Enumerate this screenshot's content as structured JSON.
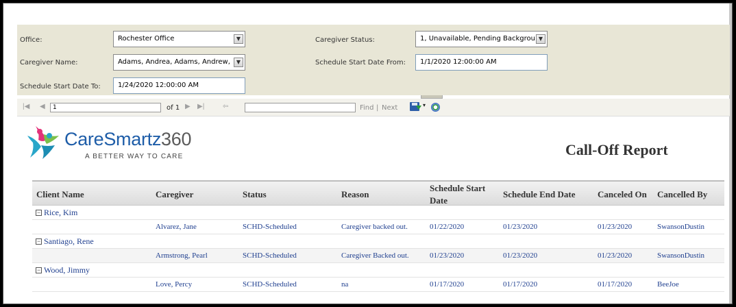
{
  "params": {
    "office_label": "Office:",
    "office_value": "Rochester Office",
    "caregiver_status_label": "Caregiver Status:",
    "caregiver_status_value": "1, Unavailable, Pending Backgrou",
    "caregiver_name_label": "Caregiver Name:",
    "caregiver_name_value": "Adams, Andrea, Adams, Andrew,",
    "start_from_label": "Schedule Start Date From:",
    "start_from_value": "1/1/2020 12:00:00 AM",
    "start_to_label": "Schedule Start Date To:",
    "start_to_value": "1/24/2020 12:00:00 AM"
  },
  "toolbar": {
    "page_value": "1",
    "of_label": "of 1",
    "find_label": "Find",
    "separator": "|",
    "next_label": "Next"
  },
  "logo": {
    "name": "CareSmartz",
    "number": "360",
    "tagline": "A BETTER WAY TO CARE"
  },
  "report": {
    "title": "Call-Off Report",
    "columns": [
      "Client Name",
      "Caregiver",
      "Status",
      "Reason",
      "Schedule Start",
      "Date",
      "Schedule End Date",
      "Canceled On",
      "Cancelled By"
    ],
    "groups": [
      {
        "client": "Rice, Kim",
        "rows": [
          {
            "caregiver": "Alvarez, Jane",
            "status": "SCHD-Scheduled",
            "reason": "Caregiver backed out.",
            "start": "01/22/2020",
            "end": "01/23/2020",
            "canceled_on": "01/23/2020",
            "cancelled_by": "SwansonDustin"
          }
        ]
      },
      {
        "client": "Santiago, Rene",
        "rows": [
          {
            "caregiver": "Armstrong, Pearl",
            "status": "SCHD-Scheduled",
            "reason": "Caregiver Backed out.",
            "start": "01/23/2020",
            "end": "01/23/2020",
            "canceled_on": "01/23/2020",
            "cancelled_by": "SwansonDustin"
          }
        ]
      },
      {
        "client": "Wood, Jimmy",
        "rows": [
          {
            "caregiver": "Love, Percy",
            "status": "SCHD-Scheduled",
            "reason": "na",
            "start": "01/17/2020",
            "end": "01/17/2020",
            "canceled_on": "01/17/2020",
            "cancelled_by": "BeeJoe"
          }
        ]
      }
    ]
  },
  "colors": {
    "param_panel_bg": "#e8e6d6",
    "link_blue": "#1f3f8f",
    "brand_blue": "#1e5da8"
  }
}
